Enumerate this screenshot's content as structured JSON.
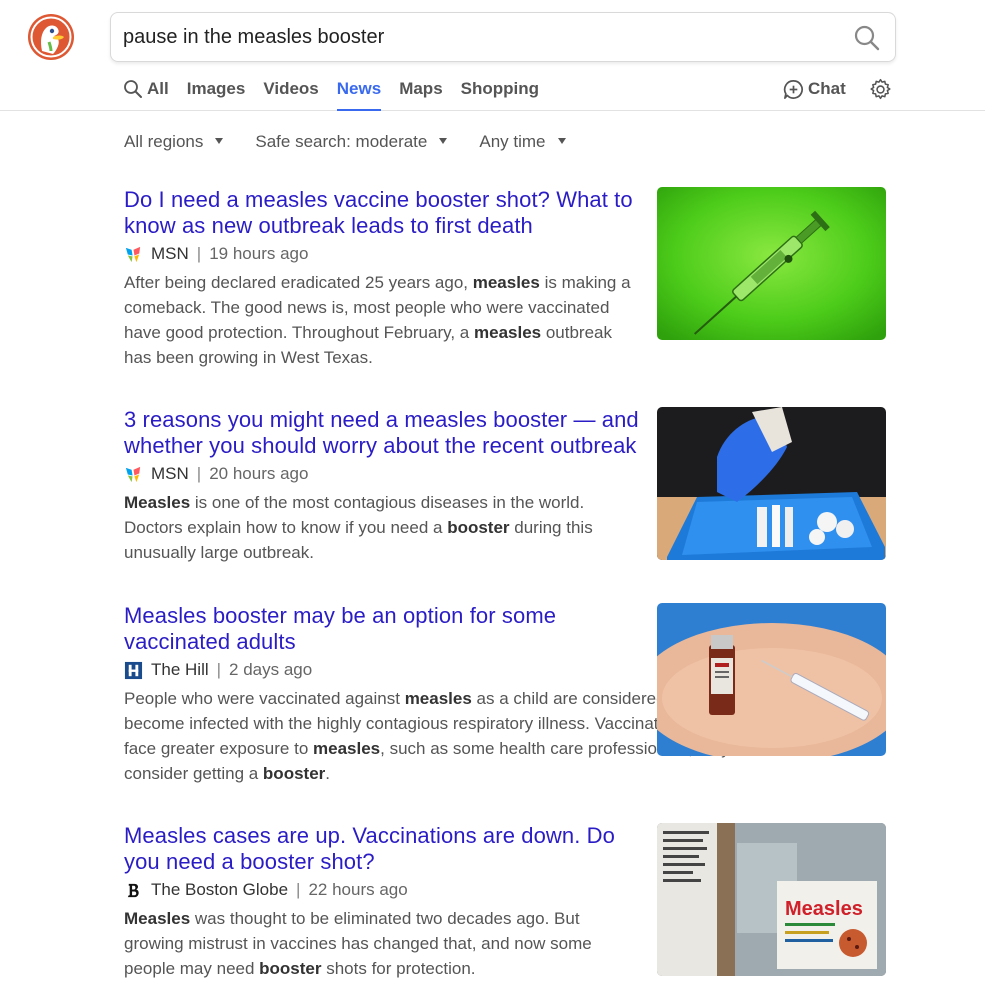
{
  "search": {
    "query": "pause in the measles booster",
    "button_label": "Search"
  },
  "tabs": [
    {
      "label": "All",
      "icon": "search-icon"
    },
    {
      "label": "Images"
    },
    {
      "label": "Videos"
    },
    {
      "label": "News",
      "active": true
    },
    {
      "label": "Maps"
    },
    {
      "label": "Shopping"
    }
  ],
  "chat": {
    "label": "Chat",
    "icon": "chat-icon"
  },
  "settings": {
    "icon": "gear-icon"
  },
  "filters": {
    "region": "All regions",
    "safe_search": "Safe search: moderate",
    "time": "Any time"
  },
  "colors": {
    "accent": "#3969ef",
    "link": "#2b1dc5"
  },
  "results": [
    {
      "title": "Do I need a measles vaccine booster shot? What to know as new outbreak leads to first death",
      "source": "MSN",
      "time": "19 hours ago",
      "snippet": [
        {
          "t": "After being declared eradicated 25 years ago, "
        },
        {
          "t": "measles",
          "b": true
        },
        {
          "t": " is making a comeback. The good news is, most people who were vaccinated have good protection. Throughout February, a "
        },
        {
          "t": "measles",
          "b": true
        },
        {
          "t": " outbreak has been growing in West Texas."
        }
      ]
    },
    {
      "title": "3 reasons you might need a measles booster — and whether you should worry about the recent outbreak",
      "source": "MSN",
      "time": "20 hours ago",
      "snippet": [
        {
          "t": "Measles",
          "b": true
        },
        {
          "t": " is one of the most contagious diseases in the world. Doctors explain how to know if you need a "
        },
        {
          "t": "booster",
          "b": true
        },
        {
          "t": " during this unusually large outbreak."
        }
      ]
    },
    {
      "title": "Measles booster may be an option for some vaccinated adults",
      "source": "The Hill",
      "time": "2 days ago",
      "snippet": [
        {
          "t": "People who were vaccinated against "
        },
        {
          "t": "measles",
          "b": true
        },
        {
          "t": " as a child are considered less likely to become infected with the highly contagious respiratory illness. Vaccinated adults who face greater exposure to "
        },
        {
          "t": "measles",
          "b": true
        },
        {
          "t": ", such as some health care professionals, may consider getting a "
        },
        {
          "t": "booster",
          "b": true
        },
        {
          "t": "."
        }
      ]
    },
    {
      "title": "Measles cases are up. Vaccinations are down. Do you need a booster shot?",
      "source": "The Boston Globe",
      "time": "22 hours ago",
      "snippet": [
        {
          "t": "Measles",
          "b": true
        },
        {
          "t": " was thought to be eliminated two decades ago. But growing mistrust in vaccines has changed that, and now some people may need "
        },
        {
          "t": "booster",
          "b": true
        },
        {
          "t": " shots for protection."
        }
      ],
      "thumb_sign_text": "Measles"
    }
  ]
}
